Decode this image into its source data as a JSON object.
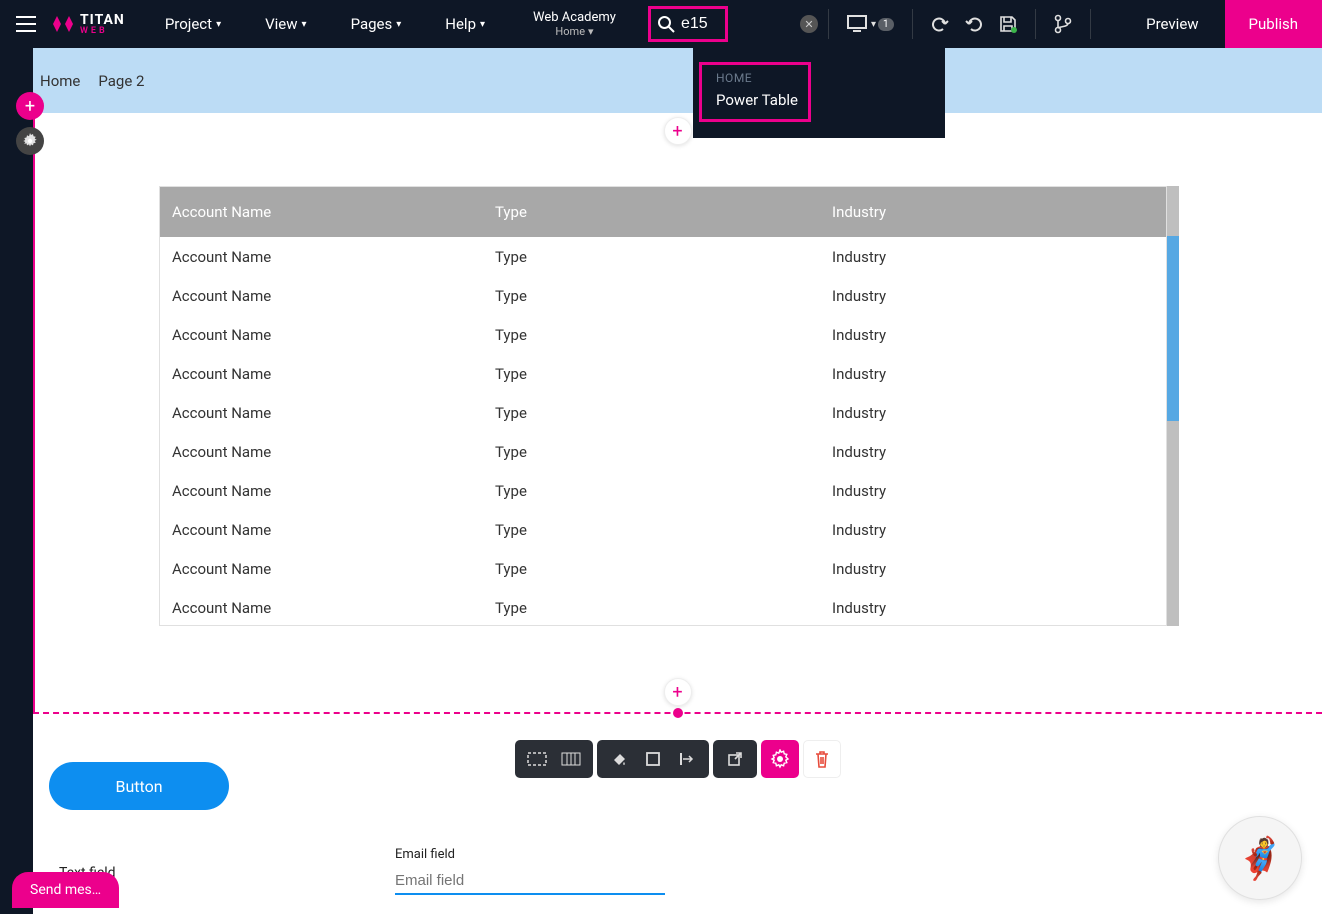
{
  "brand": {
    "name": "TITAN",
    "sub": "WEB"
  },
  "menu": {
    "project": "Project",
    "view": "View",
    "pages": "Pages",
    "help": "Help"
  },
  "projectTitle": {
    "name": "Web Academy",
    "page": "Home"
  },
  "search": {
    "value": "e15"
  },
  "searchResult": {
    "section": "HOME",
    "item": "Power Table"
  },
  "deviceBadge": "1",
  "previewLabel": "Preview",
  "publishLabel": "Publish",
  "breadcrumb": {
    "a": "Home",
    "b": "Page 2"
  },
  "table": {
    "headers": {
      "c1": "Account Name",
      "c2": "Type",
      "c3": "Industry"
    },
    "rows": [
      {
        "c1": "Account Name",
        "c2": "Type",
        "c3": "Industry"
      },
      {
        "c1": "Account Name",
        "c2": "Type",
        "c3": "Industry"
      },
      {
        "c1": "Account Name",
        "c2": "Type",
        "c3": "Industry"
      },
      {
        "c1": "Account Name",
        "c2": "Type",
        "c3": "Industry"
      },
      {
        "c1": "Account Name",
        "c2": "Type",
        "c3": "Industry"
      },
      {
        "c1": "Account Name",
        "c2": "Type",
        "c3": "Industry"
      },
      {
        "c1": "Account Name",
        "c2": "Type",
        "c3": "Industry"
      },
      {
        "c1": "Account Name",
        "c2": "Type",
        "c3": "Industry"
      },
      {
        "c1": "Account Name",
        "c2": "Type",
        "c3": "Industry"
      },
      {
        "c1": "Account Name",
        "c2": "Type",
        "c3": "Industry"
      }
    ]
  },
  "buttonLabel": "Button",
  "textFieldLabel": "Text field",
  "emailField": {
    "label": "Email field",
    "placeholder": "Email field"
  },
  "chatLabel": "Send mes…"
}
